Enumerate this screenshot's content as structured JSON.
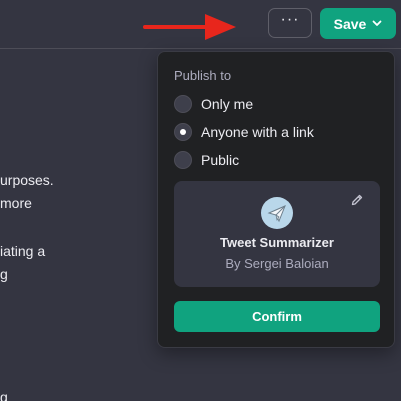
{
  "colors": {
    "background": "#343541",
    "popover": "#202123",
    "accent": "#10a37f",
    "arrow": "#e8261c"
  },
  "header": {
    "more_label": "···",
    "save_label": "Save"
  },
  "background_text": [
    "urposes.",
    "more",
    "iating a",
    "g",
    "g"
  ],
  "popover": {
    "section_label": "Publish to",
    "options": [
      {
        "label": "Only me",
        "selected": false
      },
      {
        "label": "Anyone with a link",
        "selected": true
      },
      {
        "label": "Public",
        "selected": false
      }
    ],
    "gpt": {
      "name": "Tweet Summarizer",
      "author": "By Sergei Baloian",
      "avatar_icon": "paper-plane-icon",
      "edit_icon": "pencil-icon"
    },
    "confirm_label": "Confirm"
  }
}
